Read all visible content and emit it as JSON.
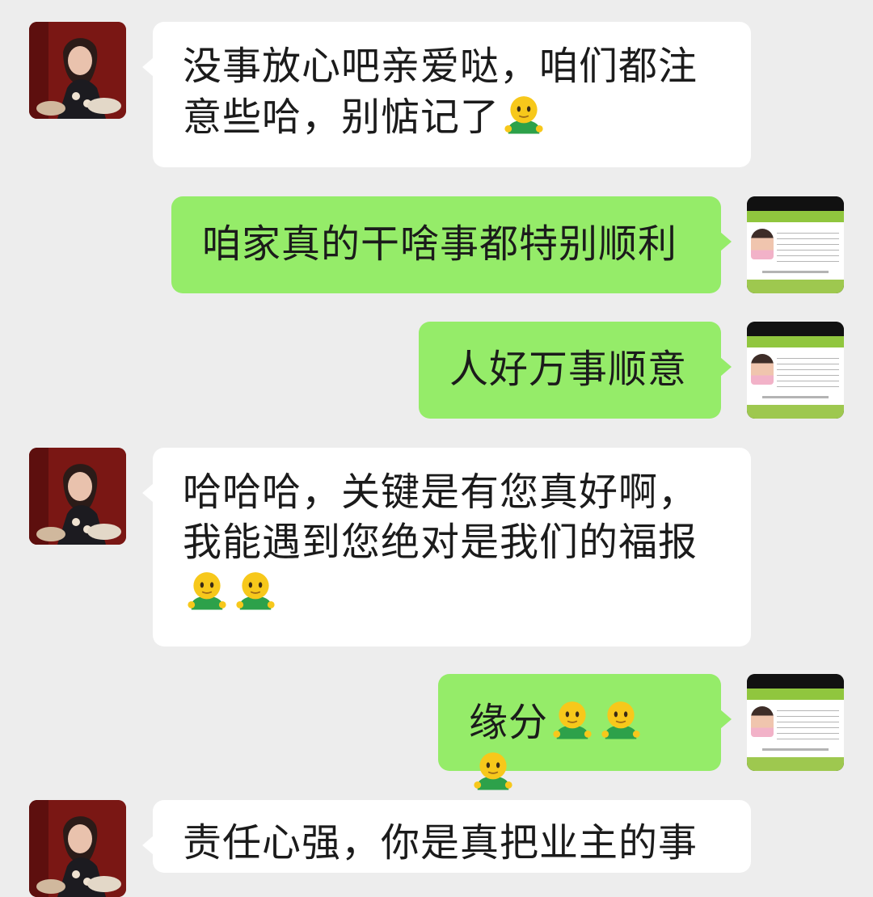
{
  "chat": {
    "messages": [
      {
        "side": "in",
        "text_lines": [
          "没事放心吧亲爱哒，咱们都注",
          "意些哈，别惦记了"
        ],
        "emoji": [
          "person-emoji"
        ]
      },
      {
        "side": "out",
        "text": "咱家真的干啥事都特别顺利",
        "emoji": []
      },
      {
        "side": "out",
        "text": "人好万事顺意",
        "emoji": []
      },
      {
        "side": "in",
        "text_lines": [
          "哈哈哈，关键是有您真好啊，",
          "我能遇到您绝对是我们的福报",
          ""
        ],
        "emoji": [
          "person-emoji",
          "person-emoji"
        ]
      },
      {
        "side": "out",
        "text": "缘分",
        "emoji": [
          "person-emoji",
          "person-emoji",
          "person-emoji"
        ]
      },
      {
        "side": "in",
        "text_lines": [
          "责任心强，你是真把业主的事"
        ],
        "emoji": []
      }
    ]
  },
  "colors": {
    "background": "#ededed",
    "incoming_bubble": "#ffffff",
    "outgoing_bubble": "#95ec69",
    "text": "#1b1b1b",
    "emoji_skin": "#f7c81b",
    "emoji_shirt": "#2da14a"
  },
  "icons": {
    "contact_avatar": "contact-avatar-photo",
    "user_avatar": "business-card-avatar",
    "emoji": "person-emoji"
  }
}
